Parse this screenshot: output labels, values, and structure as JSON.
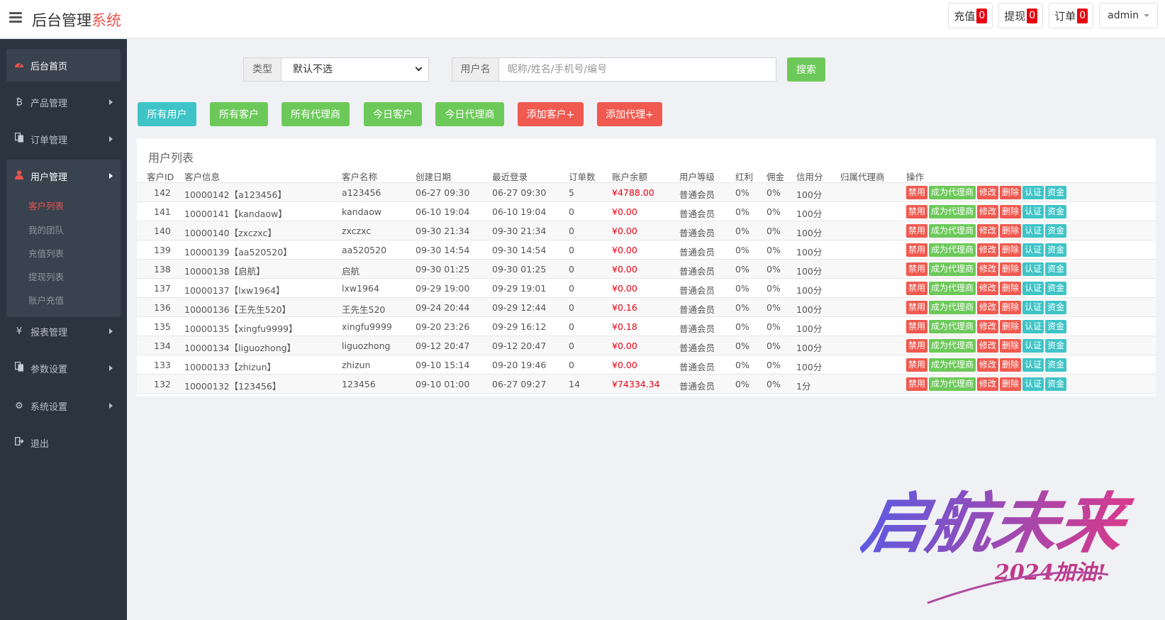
{
  "header": {
    "brand_main": "后台管理",
    "brand_accent": "系统",
    "recharge_label": "充值",
    "recharge_count": "0",
    "withdraw_label": "提现",
    "withdraw_count": "0",
    "order_label": "订单",
    "order_count": "0",
    "user": "admin"
  },
  "sidebar": {
    "home": "后台首页",
    "product": "产品管理",
    "order": "订单管理",
    "user": "用户管理",
    "sub": [
      "客户列表",
      "我的团队",
      "充值列表",
      "提现列表",
      "账户充值"
    ],
    "report": "报表管理",
    "params": "参数设置",
    "system": "系统设置",
    "logout": "退出"
  },
  "search": {
    "type_label": "类型",
    "type_value": "默认不选",
    "user_label": "用户名",
    "user_placeholder": "昵称/姓名/手机号/编号",
    "search_button": "搜索"
  },
  "filters": {
    "all_users": "所有用户",
    "all_customers": "所有客户",
    "all_agents": "所有代理商",
    "today_customers": "今日客户",
    "today_agents": "今日代理商",
    "add_customer": "添加客户+",
    "add_agent": "添加代理+"
  },
  "table": {
    "title": "用户列表",
    "columns": [
      "客户ID",
      "客户信息",
      "客户名称",
      "创建日期",
      "最近登录",
      "订单数",
      "账户余额",
      "用户等级",
      "红利",
      "佣金",
      "信用分",
      "归属代理商",
      "操作"
    ],
    "ops": [
      "禁用",
      "成为代理商",
      "修改",
      "删除",
      "认证",
      "资金"
    ],
    "rows": [
      [
        "142",
        "10000142【a123456】",
        "a123456",
        "06-27 09:30",
        "06-27 09:30",
        "5",
        "¥4788.00",
        "普通会员",
        "0%",
        "0%",
        "100分",
        ""
      ],
      [
        "141",
        "10000141【kandaow】",
        "kandaow",
        "06-10 19:04",
        "06-10 19:04",
        "0",
        "¥0.00",
        "普通会员",
        "0%",
        "0%",
        "100分",
        ""
      ],
      [
        "140",
        "10000140【zxczxc】",
        "zxczxc",
        "09-30 21:34",
        "09-30 21:34",
        "0",
        "¥0.00",
        "普通会员",
        "0%",
        "0%",
        "100分",
        ""
      ],
      [
        "139",
        "10000139【aa520520】",
        "aa520520",
        "09-30 14:54",
        "09-30 14:54",
        "0",
        "¥0.00",
        "普通会员",
        "0%",
        "0%",
        "100分",
        ""
      ],
      [
        "138",
        "10000138【启航】",
        "启航",
        "09-30 01:25",
        "09-30 01:25",
        "0",
        "¥0.00",
        "普通会员",
        "0%",
        "0%",
        "100分",
        ""
      ],
      [
        "137",
        "10000137【lxw1964】",
        "lxw1964",
        "09-29 19:00",
        "09-29 19:01",
        "0",
        "¥0.00",
        "普通会员",
        "0%",
        "0%",
        "100分",
        ""
      ],
      [
        "136",
        "10000136【王先生520】",
        "王先生520",
        "09-24 20:44",
        "09-29 12:44",
        "0",
        "¥0.16",
        "普通会员",
        "0%",
        "0%",
        "100分",
        ""
      ],
      [
        "135",
        "10000135【xingfu9999】",
        "xingfu9999",
        "09-20 23:26",
        "09-29 16:12",
        "0",
        "¥0.18",
        "普通会员",
        "0%",
        "0%",
        "100分",
        ""
      ],
      [
        "134",
        "10000134【liguozhong】",
        "liguozhong",
        "09-12 20:47",
        "09-12 20:47",
        "0",
        "¥0.00",
        "普通会员",
        "0%",
        "0%",
        "100分",
        ""
      ],
      [
        "133",
        "10000133【zhizun】",
        "zhizun",
        "09-10 15:14",
        "09-20 19:46",
        "0",
        "¥0.00",
        "普通会员",
        "0%",
        "0%",
        "100分",
        ""
      ],
      [
        "132",
        "10000132【123456】",
        "123456",
        "09-10 01:00",
        "06-27 09:27",
        "14",
        "¥74334.34",
        "普通会员",
        "0%",
        "0%",
        "1分",
        ""
      ]
    ]
  },
  "watermark": {
    "title": "启航未来",
    "subtitle": "2024加油!",
    "gradient_start": "#5b5be0",
    "gradient_end": "#d83a8a"
  }
}
